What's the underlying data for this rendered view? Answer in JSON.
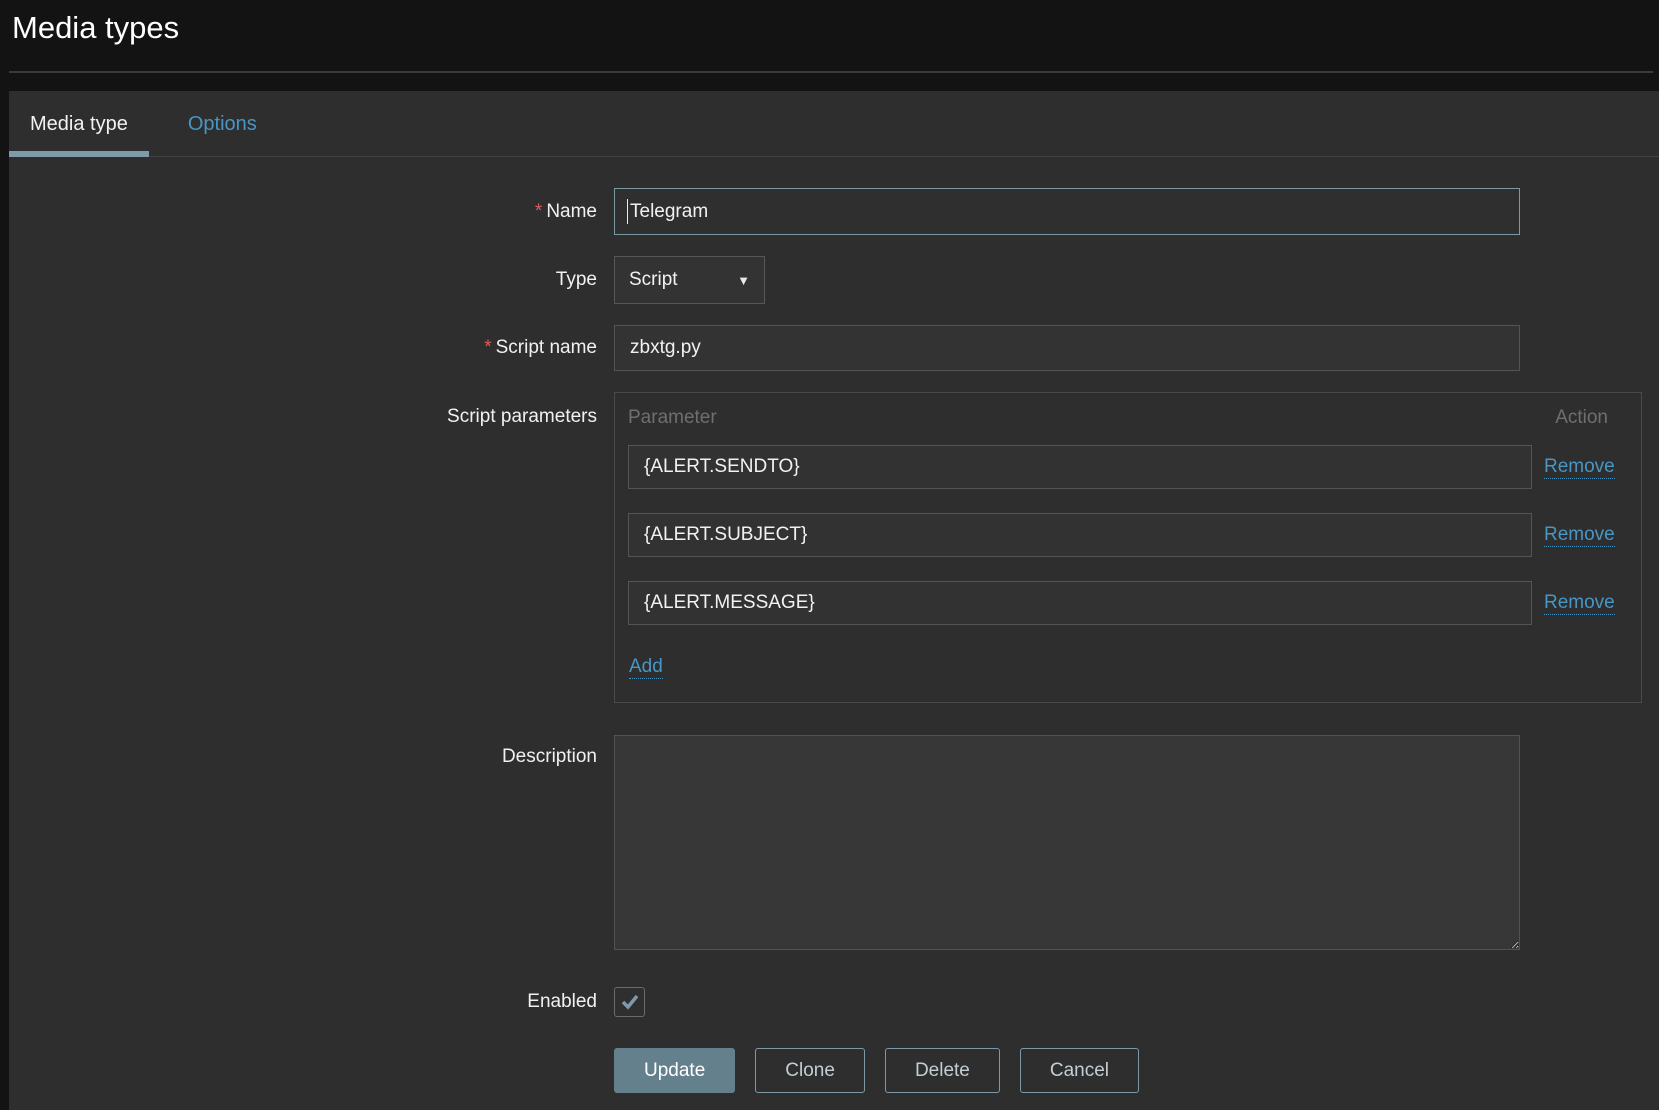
{
  "page": {
    "title": "Media types"
  },
  "tabs": [
    {
      "label": "Media type",
      "active": true
    },
    {
      "label": "Options",
      "active": false
    }
  ],
  "form": {
    "required_marker": "*",
    "name": {
      "label": "Name",
      "required": true,
      "value": "Telegram"
    },
    "type": {
      "label": "Type",
      "value": "Script"
    },
    "script_name": {
      "label": "Script name",
      "required": true,
      "value": "zbxtg.py"
    },
    "script_parameters": {
      "label": "Script parameters",
      "column_parameter": "Parameter",
      "column_action": "Action",
      "rows": [
        {
          "value": "{ALERT.SENDTO}",
          "action": "Remove"
        },
        {
          "value": "{ALERT.SUBJECT}",
          "action": "Remove"
        },
        {
          "value": "{ALERT.MESSAGE}",
          "action": "Remove"
        }
      ],
      "add_label": "Add"
    },
    "description": {
      "label": "Description",
      "value": ""
    },
    "enabled": {
      "label": "Enabled",
      "checked": true
    },
    "buttons": {
      "update": "Update",
      "clone": "Clone",
      "delete": "Delete",
      "cancel": "Cancel"
    }
  },
  "icons": {
    "dropdown_arrow": "▼"
  },
  "colors": {
    "accent_blue": "#4796c4",
    "tab_underline": "#7f9aa8",
    "button_primary": "#64808d",
    "required_red": "#e45959",
    "panel_background": "#2e2e2e",
    "page_background": "#131313"
  }
}
